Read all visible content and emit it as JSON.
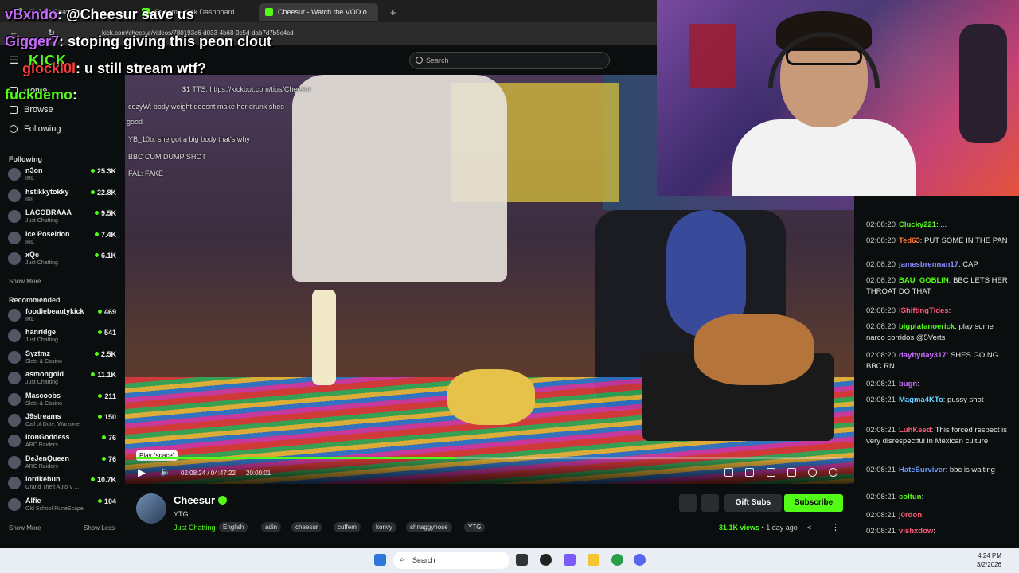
{
  "browser": {
    "tabs": [
      {
        "label": "(3) Just Chatting"
      },
      {
        "label": "Stream - Kick Dashboard"
      },
      {
        "label": "Cheesur - Watch the VOD o"
      }
    ],
    "url": "kick.com/cheesur/videos/780193c6-d033-4b68-9c5d-dab7d7b5c4cd"
  },
  "kick": {
    "logo": "KICK",
    "search_placeholder": "Search"
  },
  "sidebar": {
    "nav": [
      {
        "label": "Home"
      },
      {
        "label": "Browse"
      },
      {
        "label": "Following"
      }
    ],
    "following_header": "Following",
    "following": [
      {
        "name": "n3on",
        "category": "IRL",
        "viewers": "25.3K"
      },
      {
        "name": "hstikkytokky",
        "category": "IRL",
        "viewers": "22.8K"
      },
      {
        "name": "LACOBRAAA",
        "category": "Just Chatting",
        "viewers": "9.5K"
      },
      {
        "name": "Ice Poseidon",
        "category": "IRL",
        "viewers": "7.4K"
      },
      {
        "name": "xQc",
        "category": "Just Chatting",
        "viewers": "6.1K"
      }
    ],
    "show_more": "Show More",
    "recommended_header": "Recommended",
    "recommended": [
      {
        "name": "foodiebeautykick",
        "category": "IRL",
        "viewers": "469"
      },
      {
        "name": "hanridge",
        "category": "Just Chatting",
        "viewers": "541"
      },
      {
        "name": "Syztmz",
        "category": "Slots & Casino",
        "viewers": "2.5K"
      },
      {
        "name": "asmongold",
        "category": "Just Chatting",
        "viewers": "11.1K"
      },
      {
        "name": "Mascoobs",
        "category": "Slots & Casino",
        "viewers": "211"
      },
      {
        "name": "J9streams",
        "category": "Call of Duty: Warzone",
        "viewers": "150"
      },
      {
        "name": "IronGoddess",
        "category": "ARC Raiders",
        "viewers": "76"
      },
      {
        "name": "DeJenQueen",
        "category": "ARC Raiders",
        "viewers": "76"
      },
      {
        "name": "lordkebun",
        "category": "Grand Theft Auto V ...",
        "viewers": "10.7K"
      },
      {
        "name": "Alfie",
        "category": "Old School RuneScape",
        "viewers": "104"
      }
    ],
    "show_more_2": "Show More",
    "show_less": "Show Less"
  },
  "overlay_chat": [
    {
      "user": "vBxndo",
      "text": ": @Cheesur save us",
      "color": "#c86cff"
    },
    {
      "user": "Gigger7",
      "text": ": stoping giving this peon clout",
      "color": "#c86cff"
    },
    {
      "user": "glockl0l",
      "text": ": u still stream wtf?",
      "color": "#ff3b3b"
    },
    {
      "user": "fuckdemo",
      "text": ":",
      "color": "#53fc18"
    }
  ],
  "video_tts": [
    {
      "text": "$1 TTS: https://kickbot.com/tips/Cheesur"
    },
    {
      "text": "cozyW:  body weight doesnt make her drunk shes"
    },
    {
      "text": "good"
    },
    {
      "text": "YB_10b:  she got a big body that's why"
    },
    {
      "text": "BBC CUM DUMP SHOT"
    },
    {
      "text": "FAL:  FAKE"
    }
  ],
  "player": {
    "tooltip": "Play (space)",
    "current_time": "02:08:24 / 04:47:22",
    "clip_time": "20:00:01",
    "progress": 0.45
  },
  "channel": {
    "name": "Cheesur",
    "title": "YTG",
    "category": "Just Chatting",
    "tags": [
      "English",
      "adin",
      "cheesur",
      "cuffem",
      "konvy",
      "shnaggyhose",
      "YTG"
    ],
    "gift_label": "Gift Subs",
    "subscribe_label": "Subscribe",
    "views": "31.1K views",
    "age": "1 day ago"
  },
  "chat": [
    {
      "ts": "02:08:20",
      "user": "Clucky221",
      "text": ": ...",
      "color": "#53fc18"
    },
    {
      "ts": "02:08:20",
      "user": "Ted63",
      "text": ": PUT SOME IN THE PAN",
      "color": "#ff7a3b"
    },
    {
      "ts": "02:08:20",
      "user": "jamesbrennan17",
      "text": ": CAP",
      "color": "#8a8aff"
    },
    {
      "ts": "02:08:20",
      "user": "BAU_GOBLIN",
      "text": ": BBC LETS HER THROAT DO THAT",
      "color": "#53fc18"
    },
    {
      "ts": "02:08:20",
      "user": "iShiftingTides",
      "text": ":",
      "color": "#ff5a7a"
    },
    {
      "ts": "02:08:20",
      "user": "bigplatanoerick",
      "text": ": play some narco corridos @5Verts",
      "color": "#53fc18"
    },
    {
      "ts": "02:08:20",
      "user": "daybyday317",
      "text": ": SHES GOING BBC RN",
      "color": "#c86cff"
    },
    {
      "ts": "02:08:21",
      "user": "bugn",
      "text": ":",
      "color": "#c86cff"
    },
    {
      "ts": "02:08:21",
      "user": "Magma4KTo",
      "text": ": pussy shot",
      "color": "#6ad0ff"
    },
    {
      "ts": "02:08:21",
      "user": "LuhKeed",
      "text": ": This forced respect is very disrespectful in Mexican culture",
      "color": "#ff5a7a"
    },
    {
      "ts": "02:08:21",
      "user": "HateSurviver",
      "text": ": bbc is waiting",
      "color": "#6a9aff"
    },
    {
      "ts": "02:08:21",
      "user": "coltun",
      "text": ":",
      "color": "#53fc18"
    },
    {
      "ts": "02:08:21",
      "user": "j0rdon",
      "text": ":",
      "color": "#ff5a7a"
    },
    {
      "ts": "02:08:21",
      "user": "vishxdow",
      "text": ":",
      "color": "#ff5a7a"
    }
  ],
  "taskbar": {
    "search_placeholder": "Search",
    "time": "4:24 PM",
    "date": "3/2/2026"
  }
}
